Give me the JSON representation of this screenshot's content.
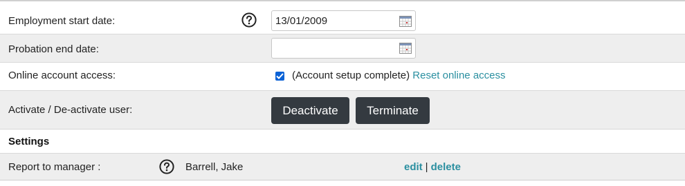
{
  "employment_start": {
    "label": "Employment start date:",
    "value": "13/01/2009",
    "help_icon": "question-circle-icon",
    "calendar_icon": "calendar-icon"
  },
  "probation_end": {
    "label": "Probation end date:",
    "value": "",
    "calendar_icon": "calendar-icon"
  },
  "online_access": {
    "label": "Online account access:",
    "checked": true,
    "status_text": "(Account setup complete)",
    "reset_link": "Reset online access"
  },
  "activation": {
    "label": "Activate / De-activate user:",
    "deactivate_label": "Deactivate",
    "terminate_label": "Terminate"
  },
  "settings": {
    "heading": "Settings"
  },
  "report_to_manager": {
    "label": "Report to manager :",
    "help_icon": "question-circle-icon",
    "manager_name": "Barrell, Jake",
    "edit_link": "edit",
    "separator": "|",
    "delete_link": "delete"
  },
  "colors": {
    "link": "#2a8fa0",
    "button_bg": "#343a40",
    "row_gray": "#eeeeee",
    "checkbox": "#0b62d6"
  }
}
